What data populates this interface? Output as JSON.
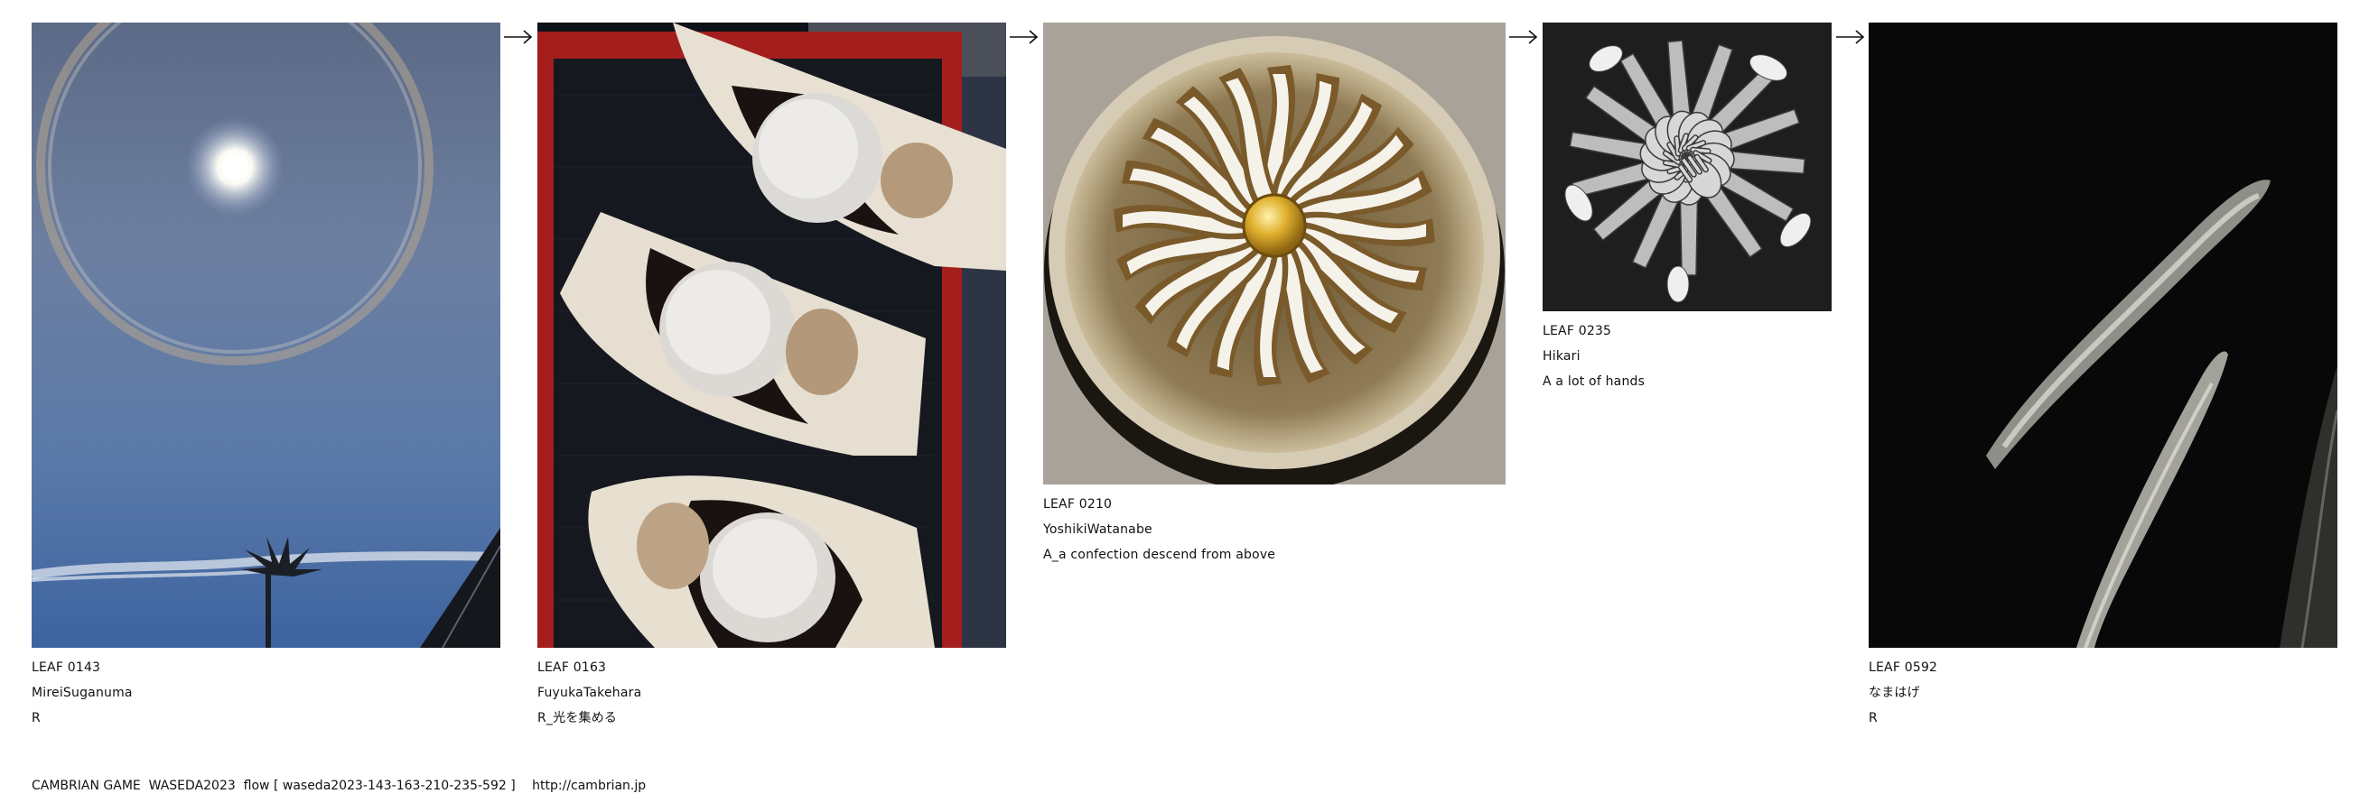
{
  "leaves": [
    {
      "id": "LEAF 0143",
      "author": "MireiSuganuma",
      "caption": "R",
      "image": "sun-halo-sky-photo"
    },
    {
      "id": "LEAF 0163",
      "author": "FuyukaTakehara",
      "caption": "R_光を集める",
      "image": "white-sweets-on-boats-photo"
    },
    {
      "id": "LEAF 0210",
      "author": "YoshikiWatanabe",
      "caption": "A_a confection descend from above",
      "image": "radial-pastry-photo"
    },
    {
      "id": "LEAF 0235",
      "author": "Hikari",
      "caption": "A a lot of hands",
      "image": "many-hands-bw-photo"
    },
    {
      "id": "LEAF 0592",
      "author": "なまはげ",
      "caption": "R",
      "image": "dark-snow-streaks-photo"
    }
  ],
  "arrow_icon": "right-arrow-icon",
  "footer": {
    "text": "CAMBRIAN GAME  WASEDA2023  flow [ waseda2023-143-163-210-235-592 ]",
    "link": "http://cambrian.jp"
  }
}
